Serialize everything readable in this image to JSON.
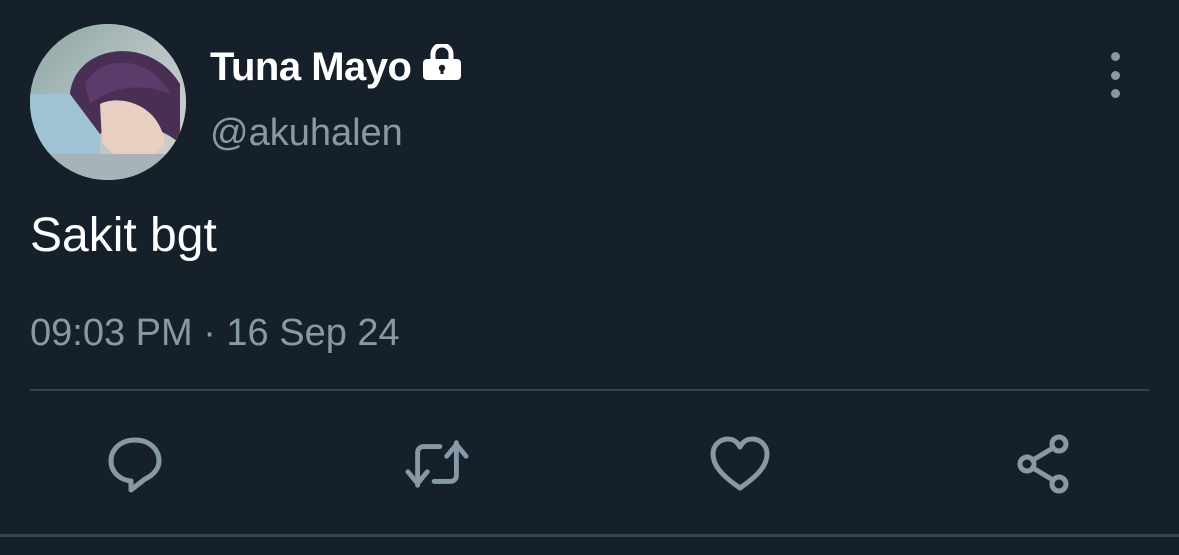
{
  "tweet": {
    "display_name": "Tuna Mayo",
    "handle": "@akuhalen",
    "text": "Sakit bgt",
    "timestamp": "09:03 PM · 16 Sep 24",
    "protected": true
  },
  "icons": {
    "lock": "lock-icon",
    "more": "more-vertical-icon",
    "reply": "reply-icon",
    "retweet": "retweet-icon",
    "like": "heart-icon",
    "share": "share-icon"
  },
  "colors": {
    "background": "#15202b",
    "primary_text": "#ffffff",
    "secondary_text": "#8899a6",
    "divider": "#38444d"
  }
}
